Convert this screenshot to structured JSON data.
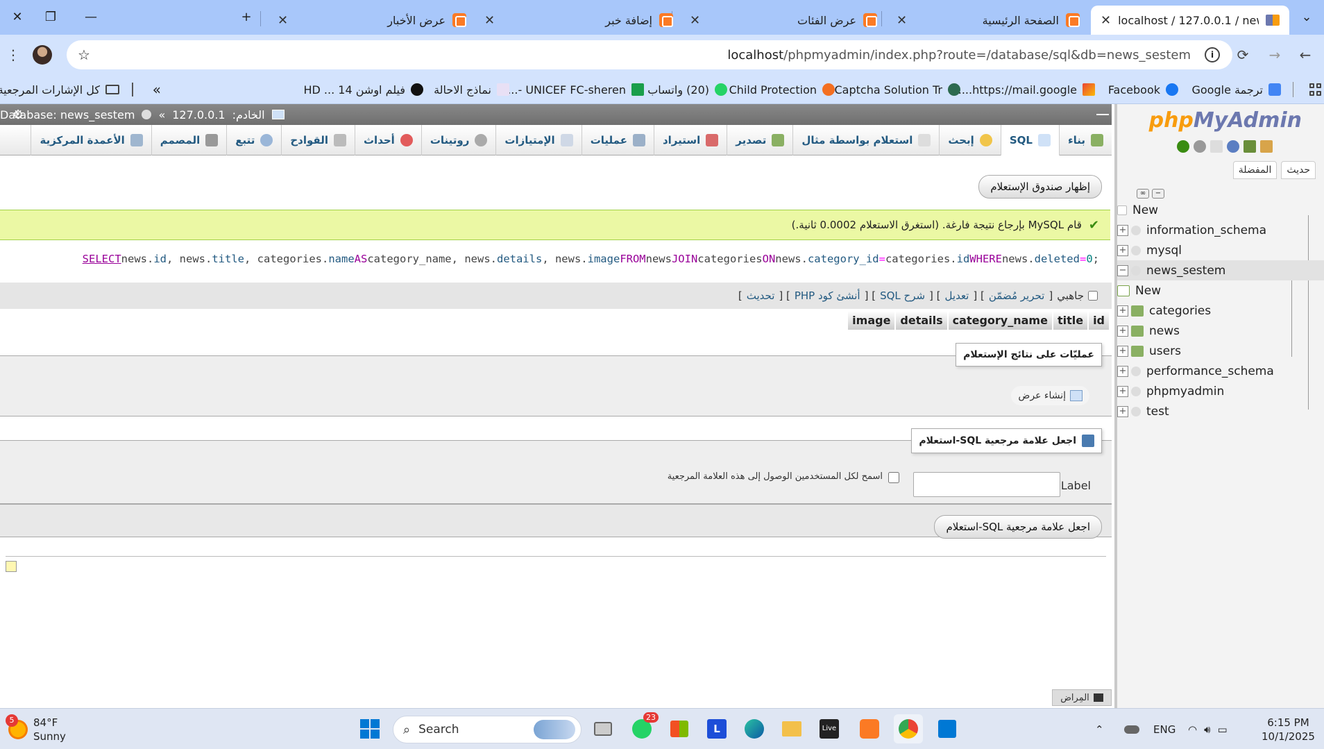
{
  "browser": {
    "tabs": [
      {
        "title": "localhost / 127.0.0.1 / news_ses",
        "active": true
      },
      {
        "title": "الصفحة الرئيسية"
      },
      {
        "title": "عرض الفئات"
      },
      {
        "title": "إضافة خبر"
      },
      {
        "title": "عرض الأخبار"
      }
    ],
    "url_host": "localhost",
    "url_path": "/phpmyadmin/index.php?route=/database/sql&db=news_sestem",
    "bookmarks": [
      "ترجمة Google",
      "Facebook",
      "https://mail.google....",
      "Captcha Solution Tr...",
      "Child Protection",
      "(20) واتساب",
      "UNICEF FC-sheren -...",
      "نماذج الاحالة",
      "فيلم اوشن 14 ... HD"
    ],
    "all_bookmarks": "كل الإشارات المرجعية",
    "more": "»"
  },
  "pma": {
    "logo_php": "php",
    "logo_myadmin": "MyAdmin",
    "nav_tabs": [
      "حديث",
      "المفضلة"
    ],
    "tree": [
      {
        "label": "New",
        "level": 0
      },
      {
        "label": "information_schema",
        "level": 0
      },
      {
        "label": "mysql",
        "level": 0
      },
      {
        "label": "news_sestem",
        "level": 0,
        "selected": true
      },
      {
        "label": "New",
        "level": 1
      },
      {
        "label": "categories",
        "level": 1
      },
      {
        "label": "news",
        "level": 1
      },
      {
        "label": "users",
        "level": 1
      },
      {
        "label": "performance_schema",
        "level": 0
      },
      {
        "label": "phpmyadmin",
        "level": 0
      },
      {
        "label": "test",
        "level": 0
      }
    ],
    "serverbar": {
      "server_label": "الخادم:",
      "server": "127.0.0.1",
      "sep": "»",
      "database": "Database: news_sestem"
    },
    "menu": [
      "بناء",
      "SQL",
      "إبحث",
      "استعلام بواسطة مثال",
      "تصدير",
      "استيراد",
      "عمليات",
      "الإمتيازات",
      "روتينات",
      "أحداث",
      "القوادح",
      "تتبع",
      "المصمم",
      "الأعمدة المركزية"
    ],
    "show_query_box": "إظهار صندوق الإستعلام",
    "success_msg": "قام MySQL بإرجاع نتيجة فارغة. (استغرق الاستعلام 0.0002 ثانية.)",
    "sql": {
      "select": "SELECT",
      "body1": " news.",
      "id": "id",
      "body2": ", news.",
      "title": "title",
      "body3": ", categories.",
      "name": "name",
      "as": " AS ",
      "cname": "category_name",
      "body4": ", news.",
      "details": "details",
      "body5": ", news.",
      "image": "image",
      "from": " FROM ",
      "news": "news",
      "join": " JOIN ",
      "categories": "categories",
      "on": " ON ",
      "news2": "news.",
      "catid": "category_id",
      "eq": " = ",
      "cat2": "categories.",
      "id2": "id",
      "where": " WHERE ",
      "news3": "news.",
      "deleted": "deleted",
      "eq2": " = ",
      "zero": "0",
      "semi": ";"
    },
    "tools": {
      "inline": "جاهبي",
      "edit_inline": "تحرير مُضمّن",
      "edit": "تعديل",
      "explain": "شرح SQL",
      "create_php": "أنشئ كود PHP",
      "refresh": "تحديث"
    },
    "columns": [
      "id",
      "title",
      "category_name",
      "details",
      "image"
    ],
    "query_results_ops": "عمليّات على نتائج الإستعلام",
    "create_view": "إنشاء عرض",
    "bookmark_legend": "اجعل علامة مرجعية SQL-استعلام",
    "label_text": "Label:",
    "label_value": "",
    "allow_all": "اسمح لكل المستخدمين الوصول إلى هذه العلامة المرجعية",
    "bookmark_button": "اجعل علامة مرجعية SQL-استعلام",
    "console": "المِراض"
  },
  "taskbar": {
    "weather_temp": "84°F",
    "weather_desc": "Sunny",
    "weather_badge": "5",
    "search": "Search",
    "whatsapp_badge": "23",
    "lang": "ENG",
    "time": "6:15 PM",
    "date": "10/1/2025"
  },
  "colors": {
    "pma_blue": "#235a81",
    "success_bg": "#ebf8a4",
    "chrome_tab": "#a8c7fa"
  }
}
